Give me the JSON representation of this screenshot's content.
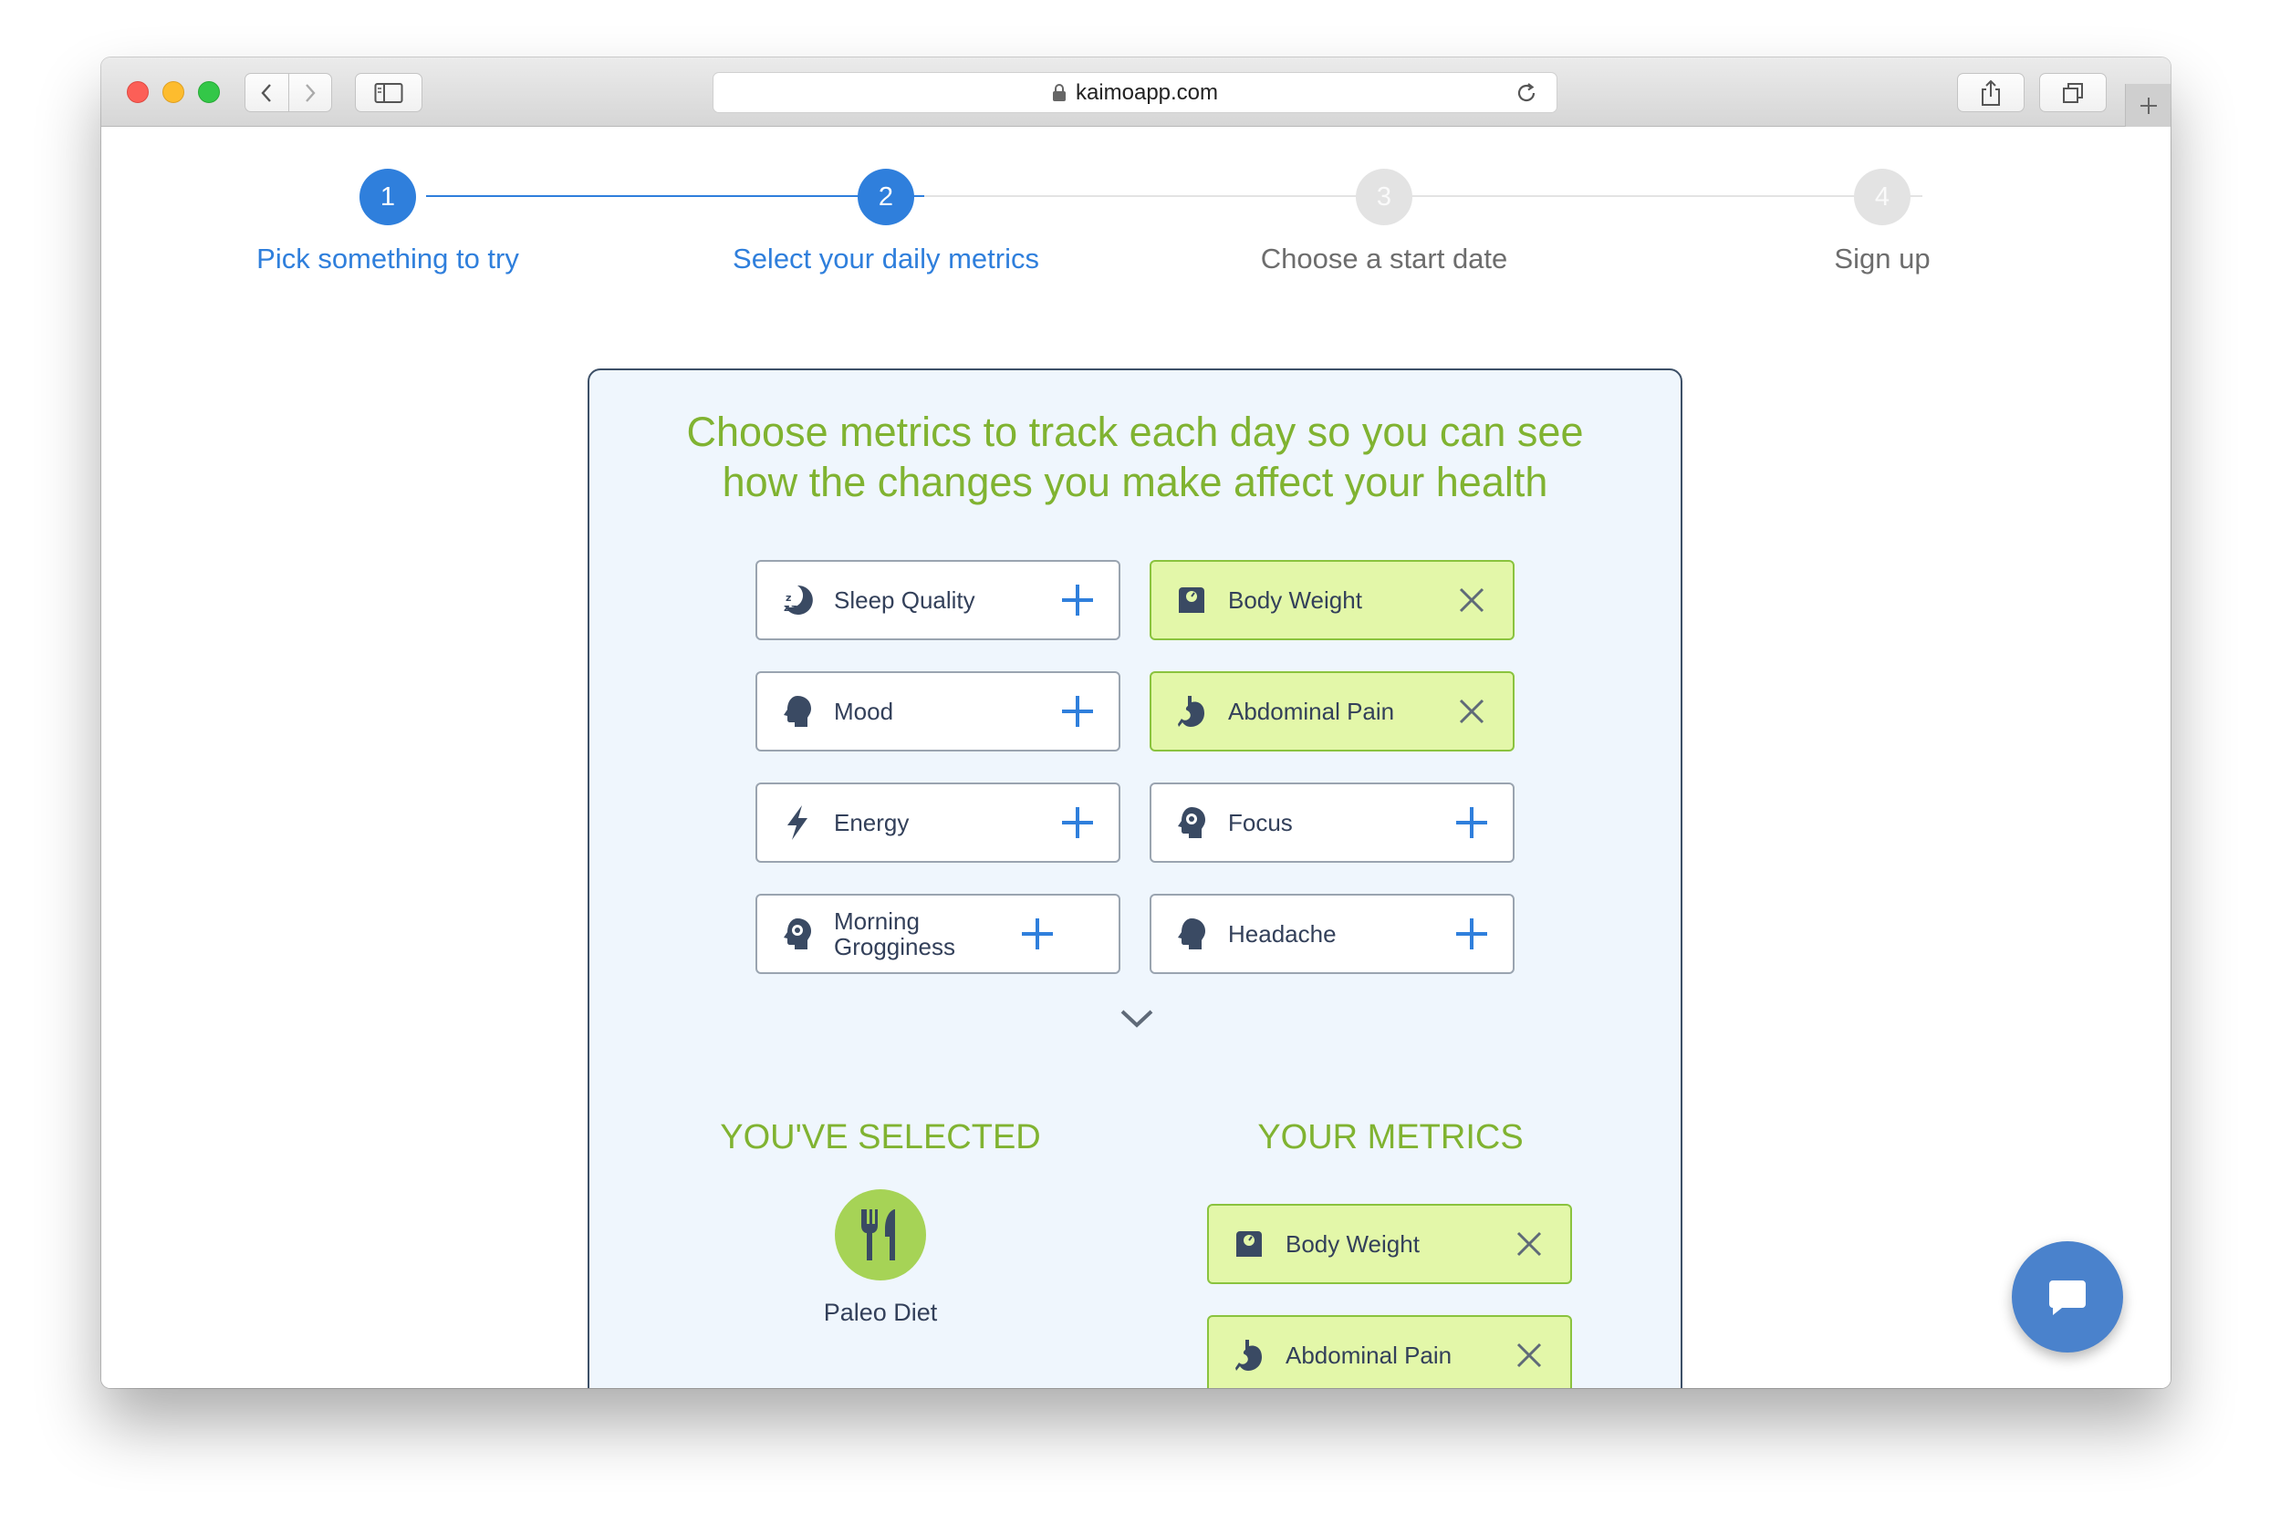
{
  "browser": {
    "url": "kaimoapp.com",
    "icons": [
      "back-icon",
      "forward-icon",
      "sidebar-icon",
      "lock-icon",
      "reload-icon",
      "share-icon",
      "tabs-icon",
      "new-tab-icon"
    ]
  },
  "stepper": {
    "steps": [
      {
        "number": "1",
        "label": "Pick something to try",
        "state": "active"
      },
      {
        "number": "2",
        "label": "Select your daily metrics",
        "state": "active"
      },
      {
        "number": "3",
        "label": "Choose a start date",
        "state": "inactive"
      },
      {
        "number": "4",
        "label": "Sign up",
        "state": "inactive"
      }
    ]
  },
  "card": {
    "title_line1": "Choose metrics to track each day so you can see",
    "title_line2": "how the changes you make affect your health",
    "metrics": [
      {
        "label": "Sleep Quality",
        "icon": "sleep-icon",
        "selected": false,
        "action": "add"
      },
      {
        "label": "Body Weight",
        "icon": "scale-icon",
        "selected": true,
        "action": "remove"
      },
      {
        "label": "Mood",
        "icon": "head-icon",
        "selected": false,
        "action": "add"
      },
      {
        "label": "Abdominal Pain",
        "icon": "stomach-icon",
        "selected": true,
        "action": "remove"
      },
      {
        "label": "Energy",
        "icon": "lightning-icon",
        "selected": false,
        "action": "add"
      },
      {
        "label": "Focus",
        "icon": "head-gear-icon",
        "selected": false,
        "action": "add"
      },
      {
        "label": "Morning Grogginess",
        "icon": "head-gear-icon",
        "selected": false,
        "action": "add"
      },
      {
        "label": "Headache",
        "icon": "head-icon",
        "selected": false,
        "action": "add"
      }
    ],
    "selected_heading": "YOU'VE SELECTED",
    "selected_item": {
      "label": "Paleo Diet",
      "icon": "fork-knife-icon"
    },
    "your_metrics_heading": "YOUR METRICS",
    "your_metrics": [
      {
        "label": "Body Weight",
        "icon": "scale-icon"
      },
      {
        "label": "Abdominal Pain",
        "icon": "stomach-icon"
      }
    ]
  },
  "colors": {
    "accent_blue": "#2f7fdc",
    "title_green": "#80b331",
    "selected_fill": "#e3f7a9",
    "card_bg": "#eff6fd",
    "chat_blue": "#4a82cc"
  }
}
